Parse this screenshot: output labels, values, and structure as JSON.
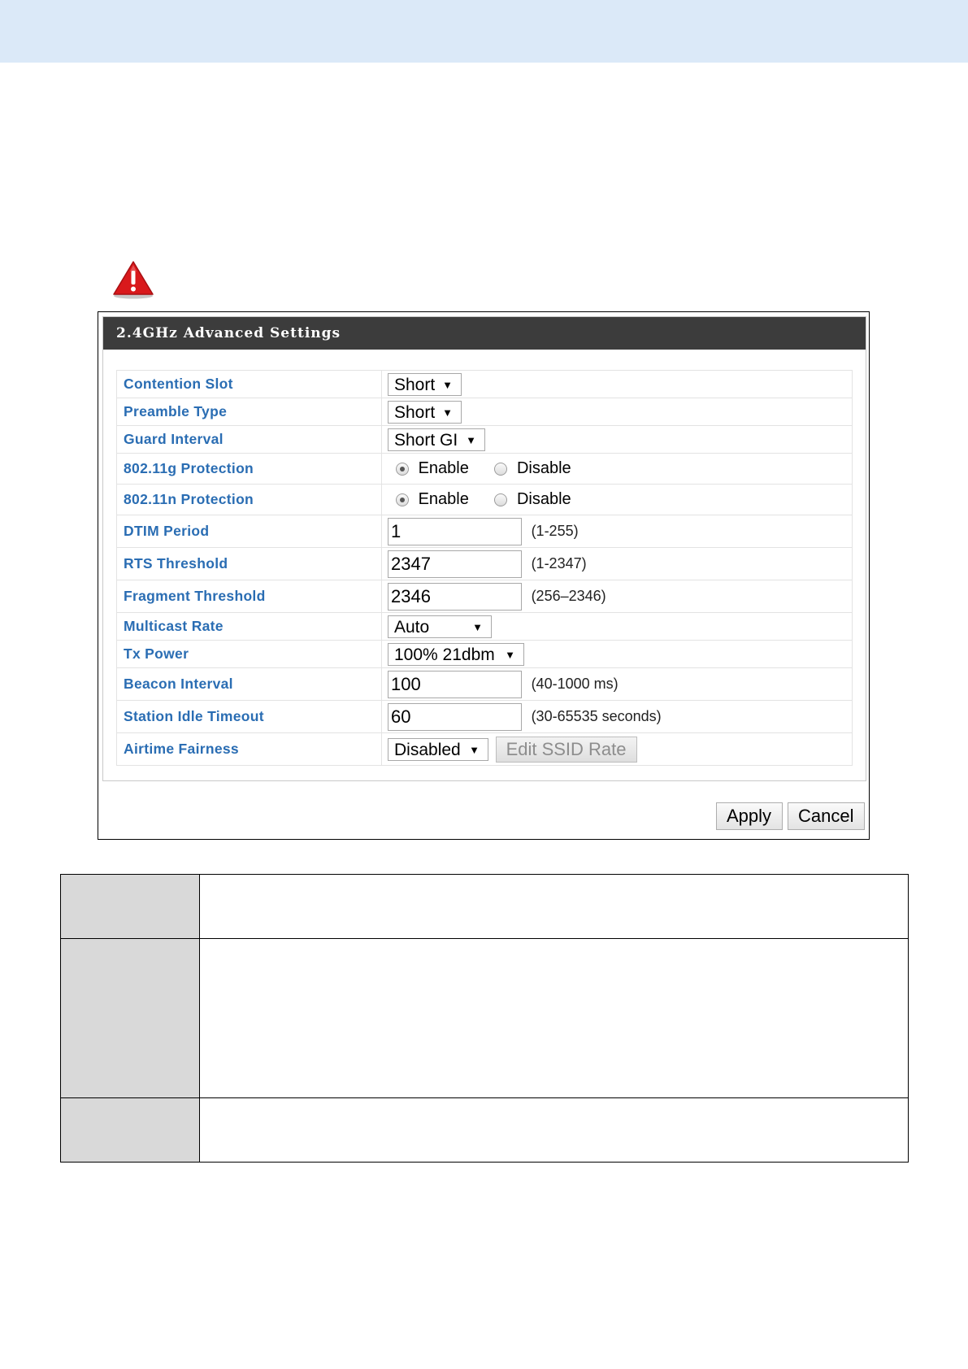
{
  "panel": {
    "title": "2.4GHz Advanced Settings",
    "rows": {
      "contention_slot": {
        "label": "Contention Slot",
        "value": "Short"
      },
      "preamble_type": {
        "label": "Preamble Type",
        "value": "Short"
      },
      "guard_interval": {
        "label": "Guard Interval",
        "value": "Short GI"
      },
      "protection_11g": {
        "label": "802.11g Protection",
        "enable": "Enable",
        "disable": "Disable",
        "selected": "Enable"
      },
      "protection_11n": {
        "label": "802.11n Protection",
        "enable": "Enable",
        "disable": "Disable",
        "selected": "Enable"
      },
      "dtim_period": {
        "label": "DTIM Period",
        "value": "1",
        "hint": "(1-255)"
      },
      "rts_threshold": {
        "label": "RTS Threshold",
        "value": "2347",
        "hint": "(1-2347)"
      },
      "fragment_threshold": {
        "label": "Fragment Threshold",
        "value": "2346",
        "hint": "(256–2346)"
      },
      "multicast_rate": {
        "label": "Multicast Rate",
        "value": "Auto"
      },
      "tx_power": {
        "label": "Tx Power",
        "value": "100% 21dbm"
      },
      "beacon_interval": {
        "label": "Beacon Interval",
        "value": "100",
        "hint": "(40-1000 ms)"
      },
      "station_idle_timeout": {
        "label": "Station Idle Timeout",
        "value": "60",
        "hint": "(30-65535 seconds)"
      },
      "airtime_fairness": {
        "label": "Airtime Fairness",
        "value": "Disabled",
        "button": "Edit SSID Rate"
      }
    },
    "dropdown_arrow": "▼"
  },
  "actions": {
    "apply": "Apply",
    "cancel": "Cancel"
  },
  "colors": {
    "label_blue": "#2a6db3",
    "header_dark": "#3c3c3c",
    "top_band": "#dbe9f8",
    "warning_red": "#d9191c"
  },
  "icons": {
    "warning": "warning-triangle-icon"
  }
}
